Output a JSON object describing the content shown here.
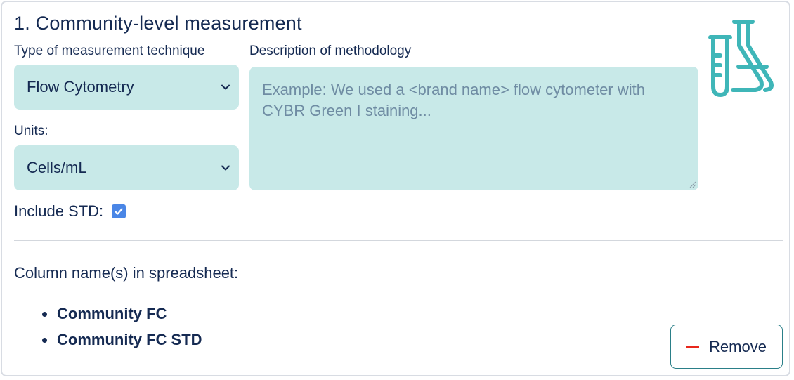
{
  "card": {
    "title": "1. Community-level measurement"
  },
  "technique": {
    "label": "Type of measurement technique",
    "selected": "Flow Cytometry"
  },
  "methodology": {
    "label": "Description of methodology",
    "placeholder": "Example: We used a <brand name> flow cytometer with CYBR Green I staining..."
  },
  "units": {
    "label": "Units:",
    "selected": "Cells/mL"
  },
  "std": {
    "label": "Include STD:",
    "checked": true
  },
  "columns": {
    "label": "Column name(s) in spreadsheet:",
    "items": [
      "Community FC",
      "Community FC STD"
    ]
  },
  "actions": {
    "remove_label": "Remove"
  },
  "icons": {
    "flask": "lab-flasks-icon",
    "chevron": "chevron-down-icon",
    "check": "checkmark-icon",
    "minus": "minus-icon"
  },
  "colors": {
    "accent_teal": "#3fb6b8",
    "field_bg": "#c8e9e8",
    "text_navy": "#152a52",
    "checkbox_blue": "#4a86e6",
    "remove_minus": "#e8271c",
    "button_border": "#2a7f88"
  }
}
